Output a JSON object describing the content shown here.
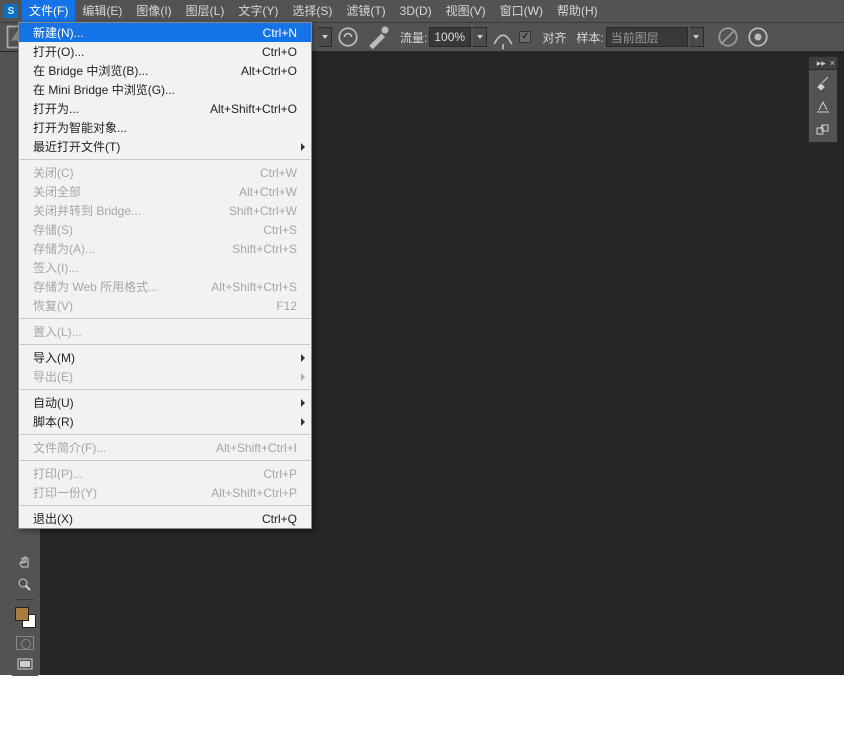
{
  "menubar": {
    "logo": "S",
    "items": [
      "文件(F)",
      "编辑(E)",
      "图像(I)",
      "图层(L)",
      "文字(Y)",
      "选择(S)",
      "滤镜(T)",
      "3D(D)",
      "视图(V)",
      "窗口(W)",
      "帮助(H)"
    ]
  },
  "options": {
    "flow_label": "流量:",
    "flow_value": "100%",
    "align_label": "对齐",
    "sample_label": "样本:",
    "sample_value": "当前图层"
  },
  "dropdown": {
    "groups": [
      [
        {
          "label": "新建(N)...",
          "shortcut": "Ctrl+N",
          "highlight": true
        },
        {
          "label": "打开(O)...",
          "shortcut": "Ctrl+O"
        },
        {
          "label": "在 Bridge 中浏览(B)...",
          "shortcut": "Alt+Ctrl+O"
        },
        {
          "label": "在 Mini Bridge 中浏览(G)..."
        },
        {
          "label": "打开为...",
          "shortcut": "Alt+Shift+Ctrl+O"
        },
        {
          "label": "打开为智能对象..."
        },
        {
          "label": "最近打开文件(T)",
          "arrow": true
        }
      ],
      [
        {
          "label": "关闭(C)",
          "shortcut": "Ctrl+W",
          "disabled": true
        },
        {
          "label": "关闭全部",
          "shortcut": "Alt+Ctrl+W",
          "disabled": true
        },
        {
          "label": "关闭并转到 Bridge...",
          "shortcut": "Shift+Ctrl+W",
          "disabled": true
        },
        {
          "label": "存储(S)",
          "shortcut": "Ctrl+S",
          "disabled": true
        },
        {
          "label": "存储为(A)...",
          "shortcut": "Shift+Ctrl+S",
          "disabled": true
        },
        {
          "label": "签入(I)...",
          "disabled": true
        },
        {
          "label": "存储为 Web 所用格式...",
          "shortcut": "Alt+Shift+Ctrl+S",
          "disabled": true
        },
        {
          "label": "恢复(V)",
          "shortcut": "F12",
          "disabled": true
        }
      ],
      [
        {
          "label": "置入(L)...",
          "disabled": true
        }
      ],
      [
        {
          "label": "导入(M)",
          "arrow": true
        },
        {
          "label": "导出(E)",
          "arrow": true,
          "disabled": true
        }
      ],
      [
        {
          "label": "自动(U)",
          "arrow": true
        },
        {
          "label": "脚本(R)",
          "arrow": true
        }
      ],
      [
        {
          "label": "文件简介(F)...",
          "shortcut": "Alt+Shift+Ctrl+I",
          "disabled": true
        }
      ],
      [
        {
          "label": "打印(P)...",
          "shortcut": "Ctrl+P",
          "disabled": true
        },
        {
          "label": "打印一份(Y)",
          "shortcut": "Alt+Shift+Ctrl+P",
          "disabled": true
        }
      ],
      [
        {
          "label": "退出(X)",
          "shortcut": "Ctrl+Q"
        }
      ]
    ]
  },
  "colors": {
    "foreground": "#a87c3f",
    "background": "#ffffff"
  }
}
